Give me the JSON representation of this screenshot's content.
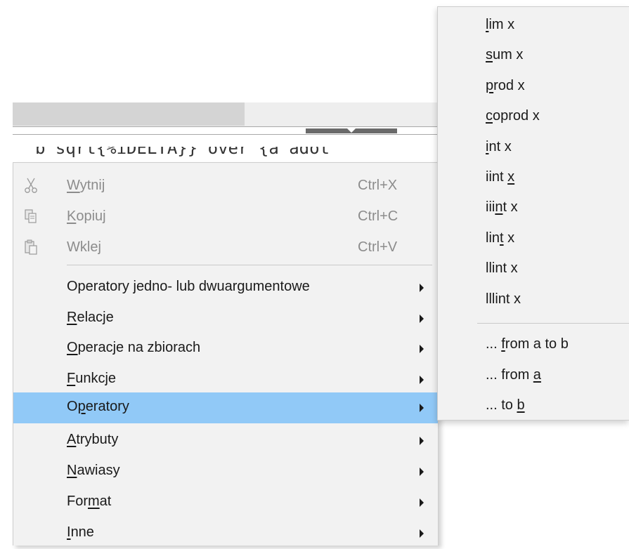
{
  "editor": {
    "formula_text": "b sqrt{%iDELTA}} over {a adot"
  },
  "context_menu": {
    "clipboard_items": [
      {
        "pre": "",
        "accel": "W",
        "post": "ytnij",
        "shortcut": "Ctrl+X",
        "icon": "scissors-icon"
      },
      {
        "pre": "",
        "accel": "K",
        "post": "opiuj",
        "shortcut": "Ctrl+C",
        "icon": "copy-icon"
      },
      {
        "pre": "Wkle",
        "accel": "j",
        "post": "",
        "shortcut": "Ctrl+V",
        "icon": "paste-icon"
      }
    ],
    "category_items": [
      {
        "pre": "Operatory ",
        "accel": "j",
        "post": "edno- lub dwuargumentowe"
      },
      {
        "pre": "",
        "accel": "R",
        "post": "elacje"
      },
      {
        "pre": "",
        "accel": "O",
        "post": "peracje na zbiorach"
      },
      {
        "pre": "",
        "accel": "F",
        "post": "unkcje"
      },
      {
        "pre": "O",
        "accel": "p",
        "post": "eratory",
        "highlighted": true
      },
      {
        "pre": "",
        "accel": "A",
        "post": "trybuty"
      },
      {
        "pre": "",
        "accel": "N",
        "post": "awiasy"
      },
      {
        "pre": "For",
        "accel": "m",
        "post": "at"
      },
      {
        "pre": "",
        "accel": "I",
        "post": "nne"
      }
    ]
  },
  "submenu": {
    "items": [
      {
        "pre": "",
        "accel": "l",
        "post": "im x"
      },
      {
        "pre": "",
        "accel": "s",
        "post": "um x"
      },
      {
        "pre": "",
        "accel": "p",
        "post": "rod x"
      },
      {
        "pre": "",
        "accel": "c",
        "post": "oprod x"
      },
      {
        "pre": "",
        "accel": "i",
        "post": "nt x"
      },
      {
        "pre": "iint ",
        "accel": "x",
        "post": ""
      },
      {
        "pre": "iii",
        "accel": "n",
        "post": "t x"
      },
      {
        "pre": "lin",
        "accel": "t",
        "post": " x"
      },
      {
        "pre": "llint x",
        "accel": "",
        "post": ""
      },
      {
        "pre": "lllint x",
        "accel": "",
        "post": ""
      }
    ],
    "range_items": [
      {
        "pre": "... ",
        "accel": "f",
        "post": "rom a to b"
      },
      {
        "pre": "... from ",
        "accel": "a",
        "post": ""
      },
      {
        "pre": "... to ",
        "accel": "b",
        "post": ""
      }
    ]
  },
  "colors": {
    "menu_background": "#f2f2f2",
    "highlight": "#91c9f7",
    "disabled_text": "#8c8c8c"
  }
}
